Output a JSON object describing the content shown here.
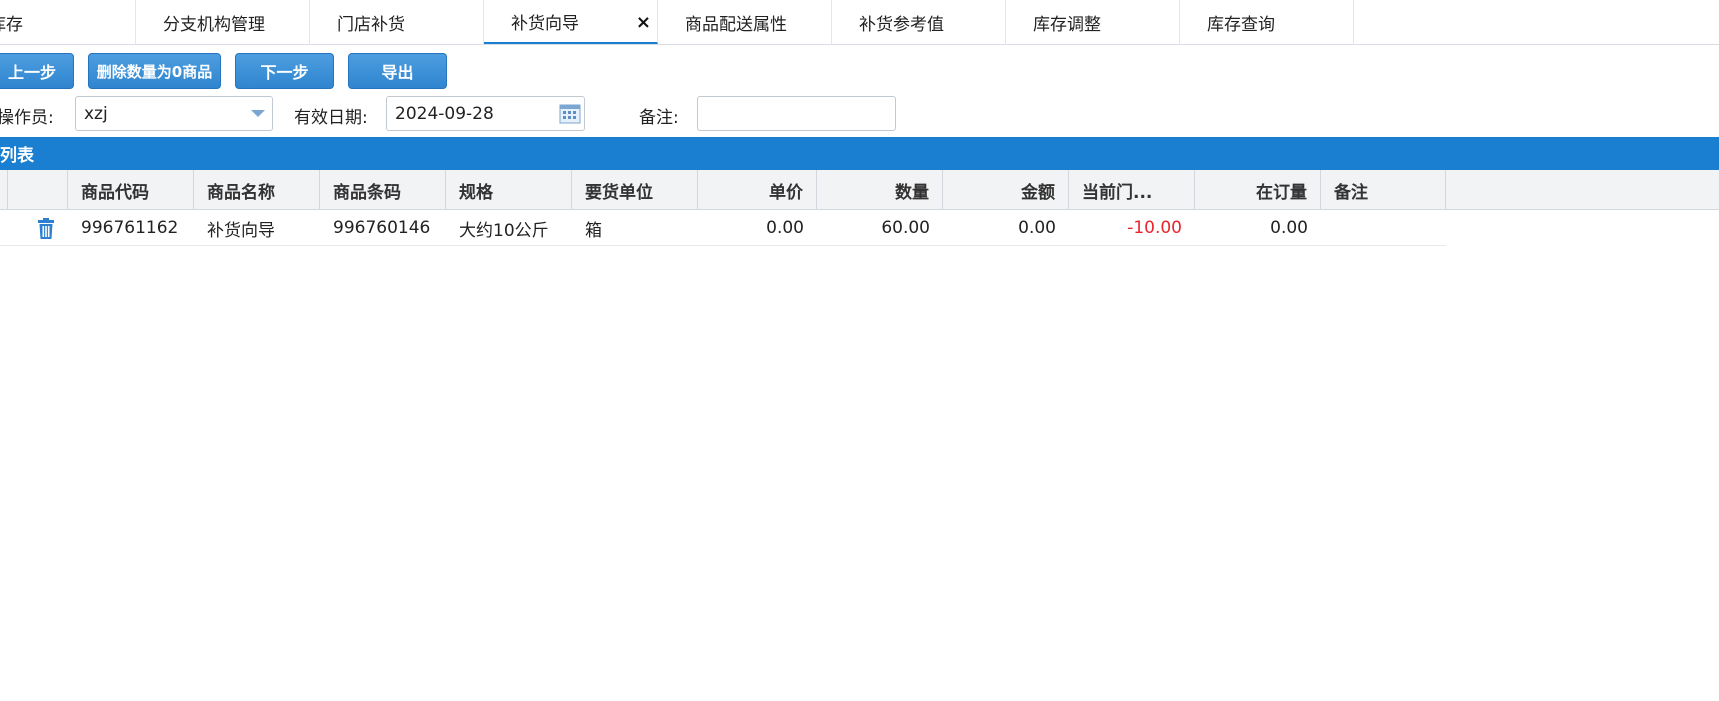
{
  "tabs": [
    {
      "label": "库存"
    },
    {
      "label": "分支机构管理"
    },
    {
      "label": "门店补货"
    },
    {
      "label": "补货向导",
      "active": true
    },
    {
      "label": "商品配送属性"
    },
    {
      "label": "补货参考值"
    },
    {
      "label": "库存调整"
    },
    {
      "label": "库存查询"
    }
  ],
  "toolbar": {
    "prev_label": "上一步",
    "delete_zero_label": "删除数量为0商品",
    "next_label": "下一步",
    "export_label": "导出"
  },
  "form": {
    "operator_label": "操作员:",
    "operator_value": "xzj",
    "valid_date_label": "有效日期:",
    "valid_date_value": "2024-09-28",
    "remark_label": "备注:",
    "remark_value": ""
  },
  "list": {
    "title": "列表",
    "columns": [
      "商品代码",
      "商品名称",
      "商品条码",
      "规格",
      "要货单位",
      "单价",
      "数量",
      "金额",
      "当前门...",
      "在订量",
      "备注"
    ],
    "rows": [
      {
        "code": "996761162",
        "name": "补货向导",
        "barcode": "996760146",
        "spec": "大约10公斤",
        "unit": "箱",
        "price": "0.00",
        "qty": "60.00",
        "amount": "0.00",
        "current": "-10.00",
        "on_order": "0.00",
        "remark": ""
      }
    ]
  },
  "colors": {
    "accent": "#1a7fd0",
    "negative": "#e8242d"
  },
  "icons": {
    "close": "close-icon",
    "dropdown": "chevron-down-icon",
    "calendar": "calendar-icon",
    "delete": "trash-icon"
  }
}
